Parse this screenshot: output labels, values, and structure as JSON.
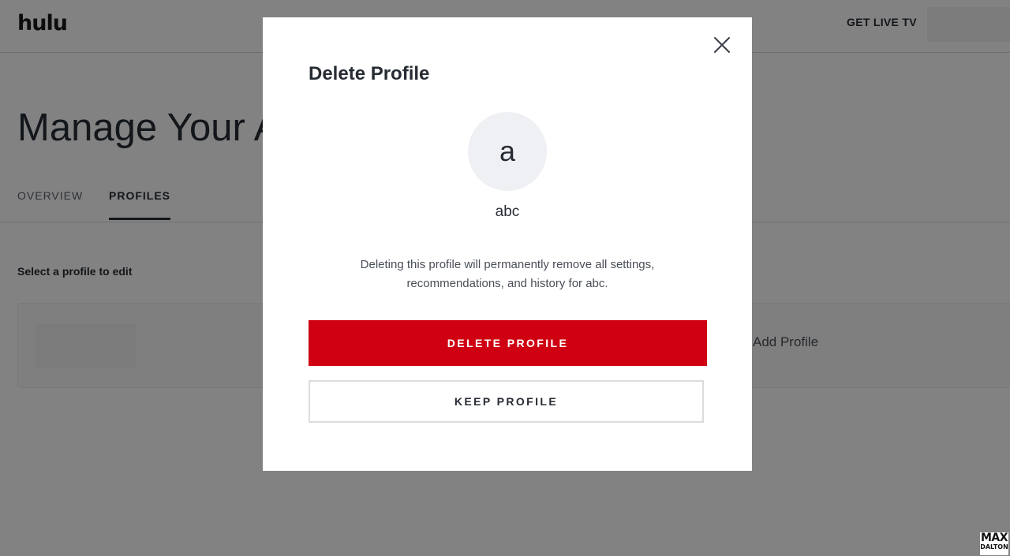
{
  "app": {
    "logo_text": "hulu",
    "header": {
      "live_tv_link": "GET LIVE TV"
    }
  },
  "page": {
    "title": "Manage Your A",
    "tabs": [
      {
        "label": "OVERVIEW",
        "active": false
      },
      {
        "label": "PROFILES",
        "active": true
      }
    ],
    "select_label": "Select a profile to edit",
    "add_profile_label": "Add Profile"
  },
  "modal": {
    "title": "Delete Profile",
    "avatar_initial": "a",
    "profile_name": "abc",
    "message_line1": "Deleting this profile will permanently remove all settings,",
    "message_line2": "recommendations, and history for abc.",
    "delete_button": "DELETE PROFILE",
    "keep_button": "KEEP PROFILE",
    "close_icon": "close-icon"
  },
  "watermark": {
    "line1": "MAX",
    "line2": "DALTON"
  },
  "colors": {
    "delete_red": "#cf0012",
    "text_dark": "#272c34",
    "avatar_bg": "#eff0f3",
    "scrim": "rgba(0,0,0,0.49)"
  }
}
